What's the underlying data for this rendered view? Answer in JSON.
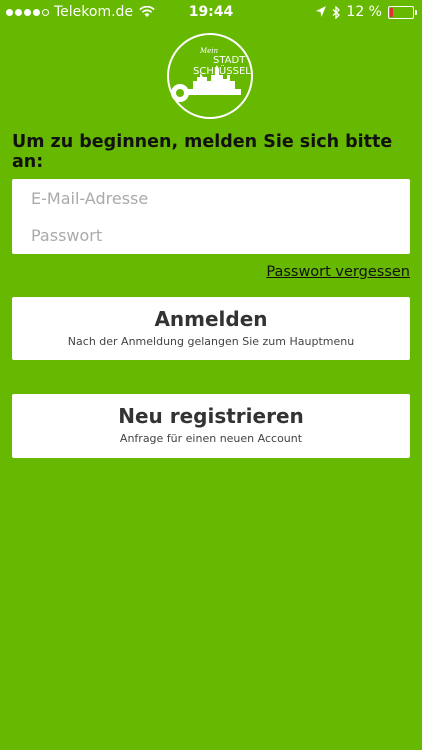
{
  "status_bar": {
    "carrier": "Telekom.de",
    "time": "19:44",
    "battery": "12 %",
    "battery_level": 0.12,
    "signal_bars": 4
  },
  "logo": {
    "line1": "Mein",
    "line2": "STADT",
    "line3": "SCHLÜSSEL"
  },
  "prompt": "Um zu beginnen, melden Sie sich bitte an:",
  "form": {
    "email_placeholder": "E-Mail-Adresse",
    "password_placeholder": "Passwort"
  },
  "forgot_password": "Passwort vergessen",
  "login": {
    "title": "Anmelden",
    "subtitle": "Nach der Anmeldung gelangen Sie zum Hauptmenu"
  },
  "register": {
    "title": "Neu registrieren",
    "subtitle": "Anfrage für einen neuen Account"
  },
  "colors": {
    "background": "#66b800",
    "battery_low": "#e03030"
  }
}
